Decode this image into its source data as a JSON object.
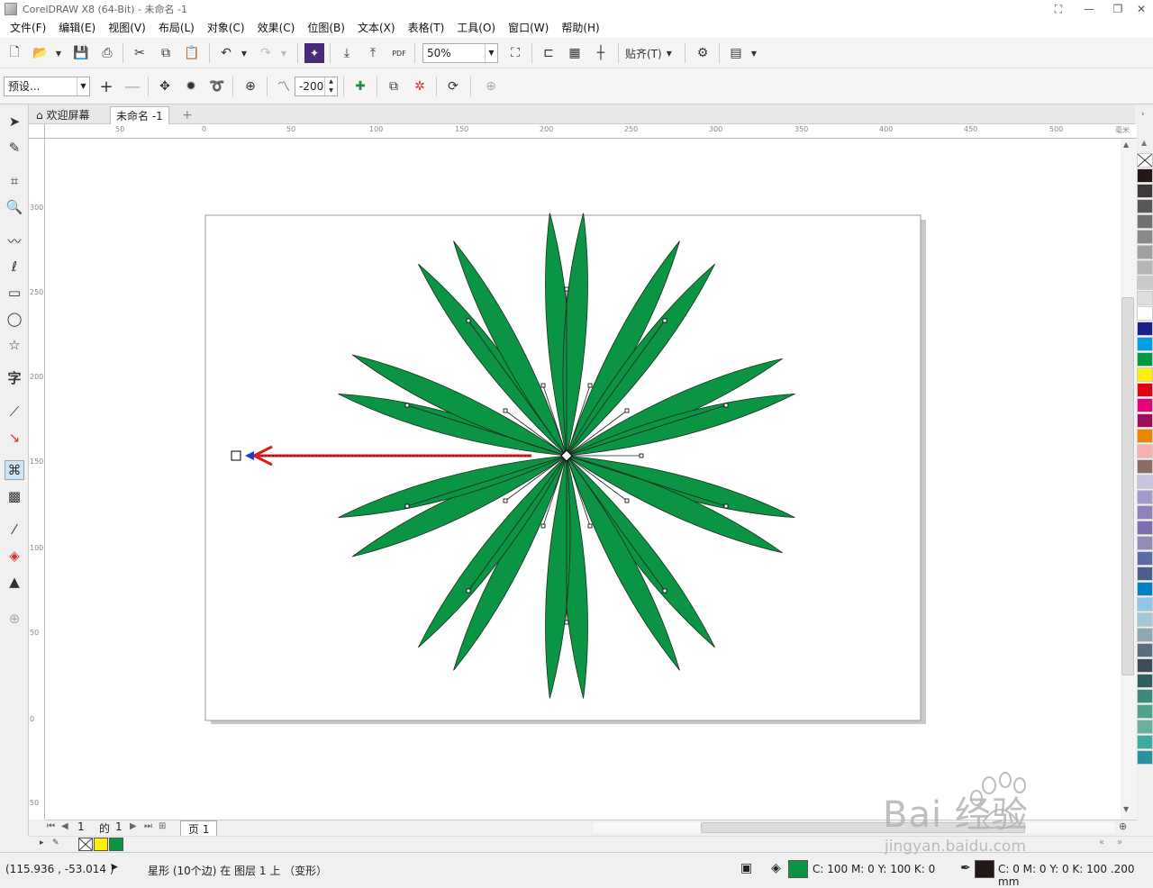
{
  "window": {
    "title": "CorelDRAW X8 (64-Bit) - 未命名 -1"
  },
  "menu": [
    "文件(F)",
    "编辑(E)",
    "视图(V)",
    "布局(L)",
    "对象(C)",
    "效果(C)",
    "位图(B)",
    "文本(X)",
    "表格(T)",
    "工具(O)",
    "窗口(W)",
    "帮助(H)"
  ],
  "toolbar": {
    "zoom_value": "50%",
    "snap_label": "贴齐(T)",
    "pdf_label": "PDF"
  },
  "property_bar": {
    "preset_value": "预设...",
    "distortion_amplitude": "-200"
  },
  "tabs": {
    "welcome": "欢迎屏幕",
    "document": "未命名 -1"
  },
  "ruler": {
    "unit_label": "毫米",
    "h_ticks": [
      "50",
      "0",
      "50",
      "100",
      "150",
      "200",
      "250",
      "300",
      "350",
      "400",
      "450",
      "500"
    ],
    "v_ticks": [
      "300",
      "250",
      "200",
      "150",
      "100",
      "50",
      "0",
      "50"
    ]
  },
  "page_nav": {
    "current": "1",
    "of_label": "的",
    "total": "1",
    "page_tab": "页 1"
  },
  "status": {
    "coordinates": "(115.936 , -53.014 )",
    "object_info": "星形 (10个边) 在 图层 1 上 （变形）",
    "fill_info": "C: 100 M: 0 Y: 100 K: 0",
    "outline_info": "C: 0 M: 0 Y: 0 K: 100  .200 mm"
  },
  "colors": {
    "accent_green": "#0a9444",
    "distort_arrow": "#d81e1e",
    "handle_blue": "#1a3fd0"
  },
  "watermark": {
    "brand": "Bai 经验",
    "url": "jingyan.baidu.com"
  }
}
